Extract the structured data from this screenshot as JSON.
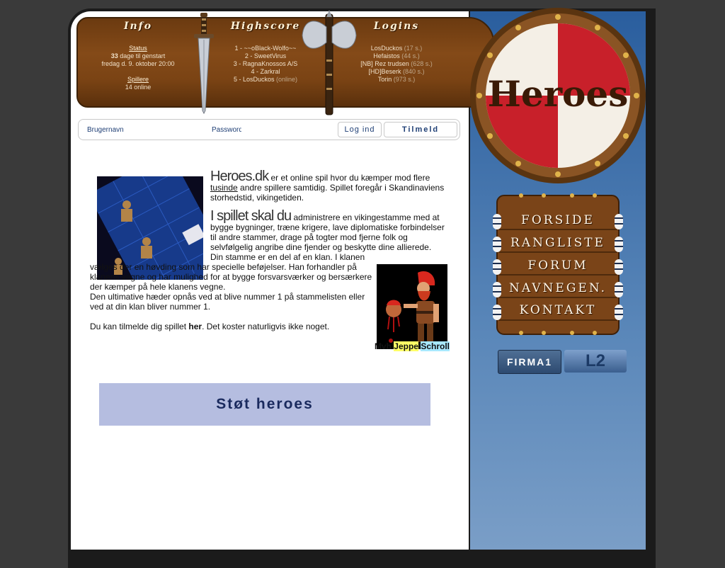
{
  "topbar": {
    "info": {
      "title": "Info",
      "status_link": "Status",
      "days_count": "33",
      "days_text": " dage til genstart",
      "date": "fredag d. 9. oktober 20:00",
      "players_link": "Spillere",
      "online": "14 online"
    },
    "highscore": {
      "title": "Highscore",
      "entries": [
        {
          "text": "1 - ~~oBlack-Wolfo~~",
          "note": ""
        },
        {
          "text": "2 - SweetVirus",
          "note": ""
        },
        {
          "text": "3 - RagnaKnossos A/S",
          "note": ""
        },
        {
          "text": "4 - Zarkral",
          "note": ""
        },
        {
          "text": "5 - LosDuckos",
          "note": "(online)"
        }
      ]
    },
    "logins": {
      "title": "Logins",
      "entries": [
        {
          "name": "LosDuckos",
          "ago": "(17 s.)"
        },
        {
          "name": "Hefaistos",
          "ago": "(44 s.)"
        },
        {
          "name": "[NB] Rez trudsen",
          "ago": "(628 s.)"
        },
        {
          "name": "[HD]Beserk",
          "ago": "(840 s.)"
        },
        {
          "name": "Torin",
          "ago": "(973 s.)"
        }
      ]
    }
  },
  "login": {
    "username_placeholder": "Brugernavn",
    "password_placeholder": "Password",
    "login_button": "Log ind",
    "signup_button": "Tilmeld"
  },
  "article": {
    "heading1": "Heroes.dk",
    "p1_a": " er et online spil hvor du kæmper mod flere ",
    "p1_link": "tusinde",
    "p1_b": " andre spillere samtidig. Spillet foregår i Skandinaviens storhedstid, vikingetiden.",
    "heading2": "I spillet skal du",
    "p2": " administrere en vikingestamme med at bygge bygninger, træne krigere, lave diplomatiske forbindelser til andre stammer, drage på togter mod fjerne folk og selvfølgelig angribe dine fjender og beskytte dine allierede.",
    "p3": "Din stamme er en del af en klan. I klanen vælges der en høvding som har specielle beføjelser. Han forhandler på klanens vegne og har mulighed for at bygge forsvarsværker og bersærkere der kæmper på hele klanens vegne.",
    "p4": "Den ultimative hæder opnås ved at blive nummer 1 på stammelisten eller ved at din klan bliver nummer 1.",
    "p5_a": "Du kan tilmelde dig spillet ",
    "p5_link": "her",
    "p5_b": ". Det koster naturligvis ikke noget.",
    "sign_prefix": "Mvh ",
    "sign_first": "Jeppe",
    "sign_last": "Schroll"
  },
  "support_banner": "Støt heroes",
  "logo_text": "Heroes",
  "menu": [
    "FORSIDE",
    "RANGLISTE",
    "FORUM",
    "NAVNEGEN.",
    "KONTAKT"
  ],
  "badges": {
    "firma": "FIRMA1",
    "l2": "L2"
  },
  "colors": {
    "brown": "#7a4314",
    "blue": "#2a5e9e",
    "red": "#c8202a",
    "highlight_yellow": "#ffff66",
    "highlight_cyan": "#a8e8ff"
  }
}
